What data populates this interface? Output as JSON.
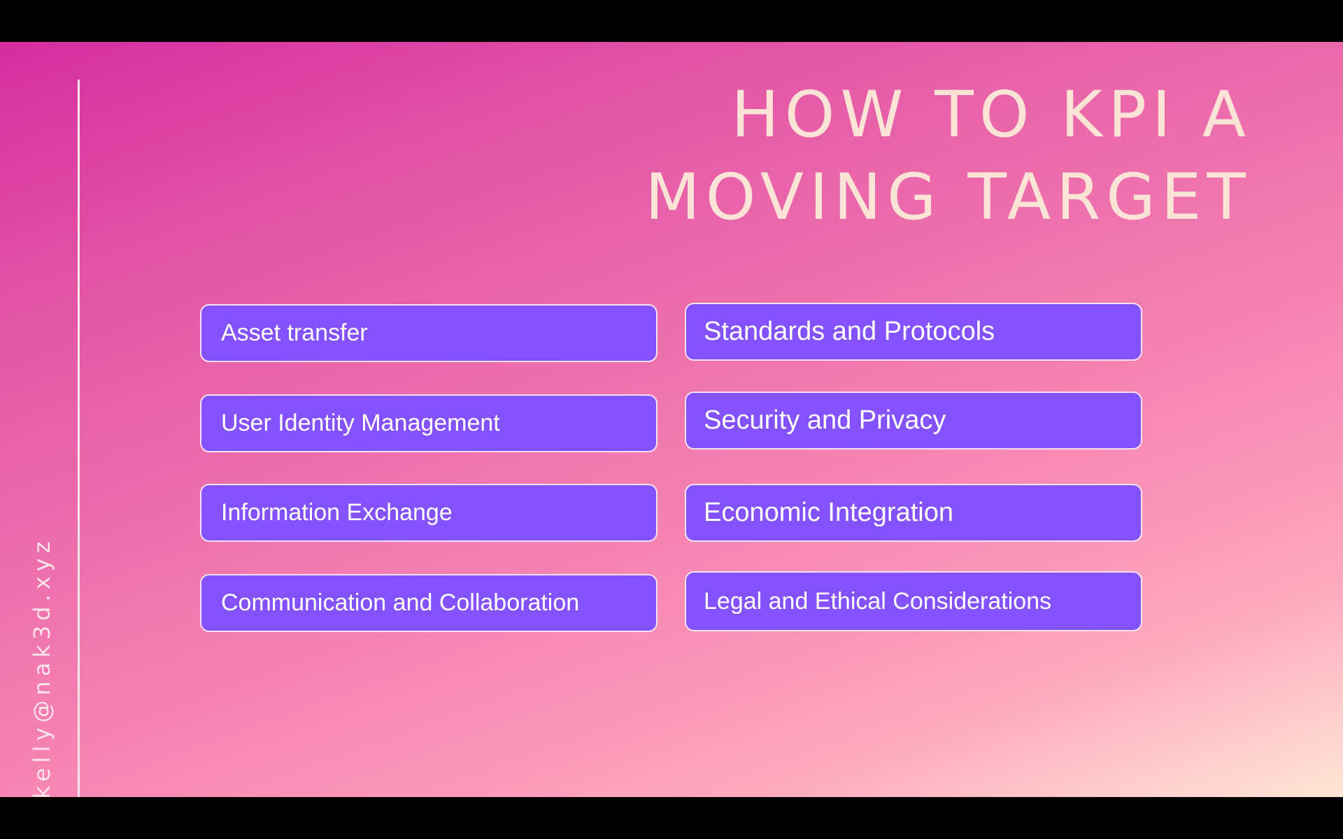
{
  "slide": {
    "title_line_1": "HOW TO KPI A",
    "title_line_2": "MOVING TARGET",
    "contact_email": "kelly@nak3d.xyz"
  },
  "left_items": [
    "Asset transfer",
    "User Identity Management",
    "Information Exchange",
    "Communication and Collaboration"
  ],
  "right_items": [
    "Standards and Protocols",
    "Security and Privacy",
    "Economic Integration",
    "Legal and Ethical Considerations"
  ],
  "colors": {
    "box_fill": "#8452fd",
    "box_border": "#f8e2ef",
    "title_text": "#fbe4d5",
    "gradient_start": "#d52ea0",
    "gradient_end": "#ffe6d6"
  }
}
